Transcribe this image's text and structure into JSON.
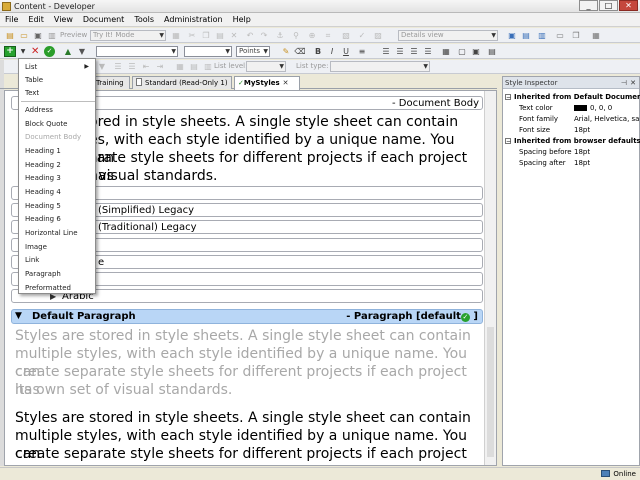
{
  "window": {
    "title": "Content - Developer",
    "minimize": "_",
    "maximize": "□",
    "close": "✕"
  },
  "menubar": [
    "File",
    "Edit",
    "View",
    "Document",
    "Tools",
    "Administration",
    "Help"
  ],
  "toolbar1": {
    "preview_label": "Preview",
    "tryit_value": "Try It! Mode",
    "view_value": "Details view"
  },
  "toolbar2": {
    "size_unit": "Points",
    "bold": "B",
    "italic": "I",
    "underline": "U",
    "list_level_label": "List level:",
    "list_type_label": "List type:"
  },
  "tabs": [
    {
      "label": "Training",
      "active": false
    },
    {
      "label": "Standard (Read-Only 1)",
      "active": false
    },
    {
      "label": "MyStyles",
      "active": true
    }
  ],
  "insert_menu": {
    "items": [
      {
        "label": "List",
        "submenu": true,
        "disabled": false
      },
      {
        "label": "Table",
        "disabled": false
      },
      {
        "label": "Text",
        "disabled": false
      },
      {
        "label": "Address",
        "disabled": false
      },
      {
        "label": "Block Quote",
        "disabled": false
      },
      {
        "label": "Document Body",
        "disabled": true
      },
      {
        "label": "Heading 1",
        "disabled": false
      },
      {
        "label": "Heading 2",
        "disabled": false
      },
      {
        "label": "Heading 3",
        "disabled": false
      },
      {
        "label": "Heading 4",
        "disabled": false
      },
      {
        "label": "Heading 5",
        "disabled": false
      },
      {
        "label": "Heading 6",
        "disabled": false
      },
      {
        "label": "Horizontal Line",
        "disabled": false
      },
      {
        "label": "Image",
        "disabled": false
      },
      {
        "label": "Link",
        "disabled": false
      },
      {
        "label": "Paragraph",
        "disabled": false
      },
      {
        "label": "Preformatted",
        "disabled": false
      }
    ]
  },
  "editor": {
    "document_body_label": "- Document Body",
    "sample_lines_top": [
      "ored in style sheets. A single style sheet can contain",
      "es, with each style identified by a unique name. You can",
      "arate style sheets for different projects if each project has",
      "f visual standards."
    ],
    "style_rows": [
      {
        "label": ""
      },
      {
        "label": "(Simplified) Legacy"
      },
      {
        "label": "(Traditional) Legacy"
      },
      {
        "label": ""
      },
      {
        "label": "e"
      },
      {
        "label": ""
      }
    ],
    "arabic_label": "Arabic",
    "default_paragraph": {
      "name": "Default Paragraph",
      "tag": "- Paragraph [default",
      "ok_glyph": "✓",
      "close": "]"
    },
    "sample_grey": [
      "Styles are stored in style sheets. A single style sheet can contain",
      "multiple styles, with each style identified by a unique name. You can",
      "create separate style sheets for different projects if each project has",
      "its own set of visual standards."
    ],
    "sample_black": [
      "Styles are stored in style sheets. A single style sheet can contain",
      "multiple styles, with each style identified by a unique name. You can",
      "create separate style sheets for different projects if each project has"
    ]
  },
  "style_inspector": {
    "title": "Style Inspector",
    "group1": "Inherited from Default Document Bo",
    "props1": [
      {
        "name": "Text color",
        "value": "0, 0, 0",
        "swatch": "#000000"
      },
      {
        "name": "Font family",
        "value": "Arial, Helvetica, sa"
      },
      {
        "name": "Font size",
        "value": "18pt"
      }
    ],
    "group2": "Inherited from browser defaults",
    "props2": [
      {
        "name": "Spacing before",
        "value": "18pt"
      },
      {
        "name": "Spacing after",
        "value": "18pt"
      }
    ]
  },
  "status": {
    "online": "Online"
  },
  "colors": {
    "accent": "#b9d6f6",
    "ok_green": "#27a12e",
    "close_red": "#c5473c"
  }
}
